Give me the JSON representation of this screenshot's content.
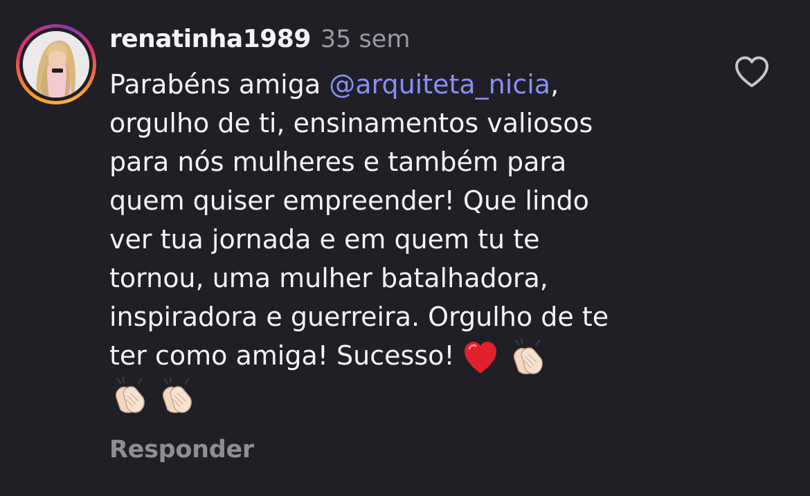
{
  "comment": {
    "username": "renatinha1989",
    "time": "35 sem",
    "text_prefix": "Parabéns amiga ",
    "mention": "@arquiteta_nicia",
    "text_after_mention": ",",
    "lines": [
      "orgulho de ti, ensinamentos valiosos",
      "para nós mulheres e também para",
      "quem quiser empreender! Que lindo",
      "ver tua jornada e em quem tu te",
      "tornou, uma mulher batalhadora,",
      "inspiradora e guerreira. Orgulho de te"
    ],
    "last_line": "ter como amiga! Sucesso!",
    "emojis": [
      "red-heart-icon",
      "clapping-hands-icon",
      "clapping-hands-icon",
      "clapping-hands-icon"
    ],
    "reply_label": "Responder",
    "like_icon": "heart-outline-icon"
  },
  "colors": {
    "background": "#1f1f25",
    "mention": "#8b8ff5",
    "muted": "#9a9aa2",
    "heart": "#e0202c"
  }
}
